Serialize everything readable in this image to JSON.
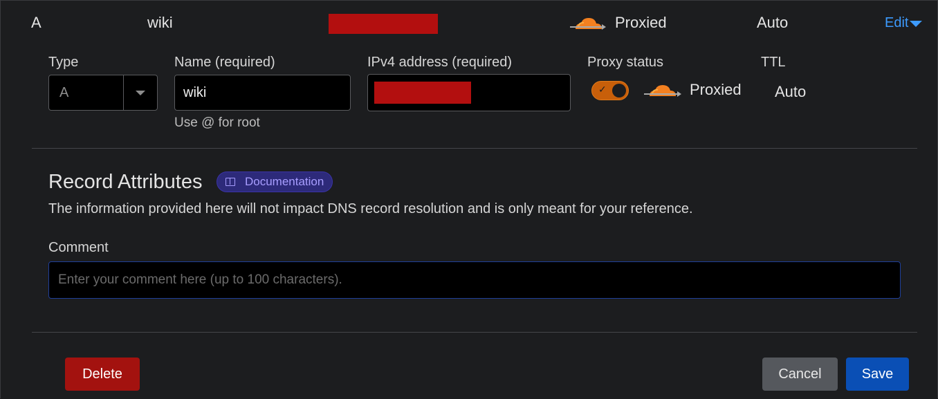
{
  "record": {
    "type": "A",
    "name": "wiki",
    "proxy_status": "Proxied",
    "ttl": "Auto",
    "edit_label": "Edit"
  },
  "form": {
    "type_label": "Type",
    "type_value": "A",
    "name_label": "Name (required)",
    "name_value": "wiki",
    "name_hint": "Use @ for root",
    "ipv4_label": "IPv4 address (required)",
    "proxy_label": "Proxy status",
    "proxy_value": "Proxied",
    "proxy_enabled": true,
    "ttl_label": "TTL",
    "ttl_value": "Auto"
  },
  "attributes": {
    "title": "Record Attributes",
    "doc_badge": "Documentation",
    "description": "The information provided here will not impact DNS record resolution and is only meant for your reference.",
    "comment_label": "Comment",
    "comment_placeholder": "Enter your comment here (up to 100 characters)."
  },
  "actions": {
    "delete": "Delete",
    "cancel": "Cancel",
    "save": "Save"
  },
  "colors": {
    "accent_orange": "#f38020",
    "link_blue": "#3d9bff",
    "delete_red": "#a3120f",
    "save_blue": "#0a4fb5",
    "redaction": "#b30f0f"
  },
  "icons": {
    "cloud": "cloudflare-cloud-icon",
    "dropdown": "chevron-down-icon",
    "book": "book-icon",
    "check": "check-icon"
  }
}
